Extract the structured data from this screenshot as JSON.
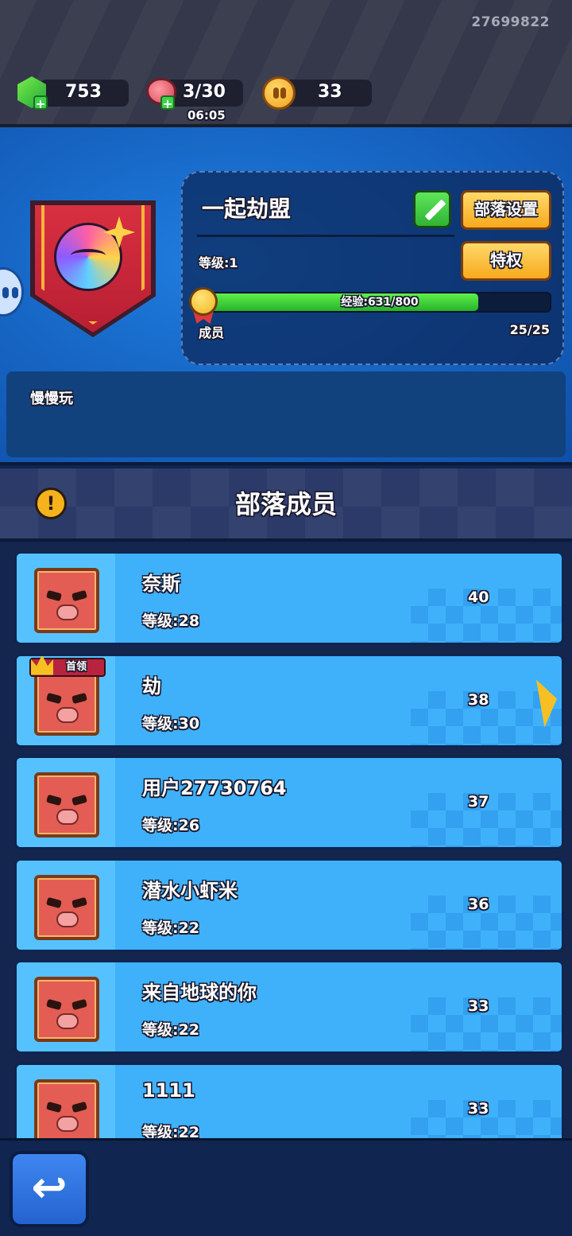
{
  "top_bar": {
    "user_id": "27699822",
    "gems": "753",
    "stamina": "3/30",
    "stamina_timer": "06:05",
    "coins": "33"
  },
  "guild": {
    "name": "一起劫盟",
    "settings_label": "部落设置",
    "privilege_label": "特权",
    "level": "等级:1",
    "xp_text": "经验:631/800",
    "xp_fraction": 0.79,
    "members_label": "成员",
    "members_count": "25/25",
    "motto": "慢慢玩"
  },
  "members_section": {
    "title": "部落成员"
  },
  "members": [
    {
      "name": "奈斯",
      "level": "等级:28",
      "score": "40",
      "leader": false
    },
    {
      "name": "劫",
      "level": "等级:30",
      "score": "38",
      "leader": true,
      "leader_tag": "首领"
    },
    {
      "name": "用户27730764",
      "level": "等级:26",
      "score": "37",
      "leader": false
    },
    {
      "name": "潜水小虾米",
      "level": "等级:22",
      "score": "36",
      "leader": false
    },
    {
      "name": "来自地球的你",
      "level": "等级:22",
      "score": "33",
      "leader": false
    },
    {
      "name": "1111",
      "level": "等级:22",
      "score": "33",
      "leader": false
    }
  ],
  "icons": {
    "gem": "gem-icon",
    "meat": "meat-icon",
    "coin": "coin-icon",
    "edit": "pencil-icon",
    "warning": "exclamation-icon",
    "back": "back-arrow-icon"
  }
}
